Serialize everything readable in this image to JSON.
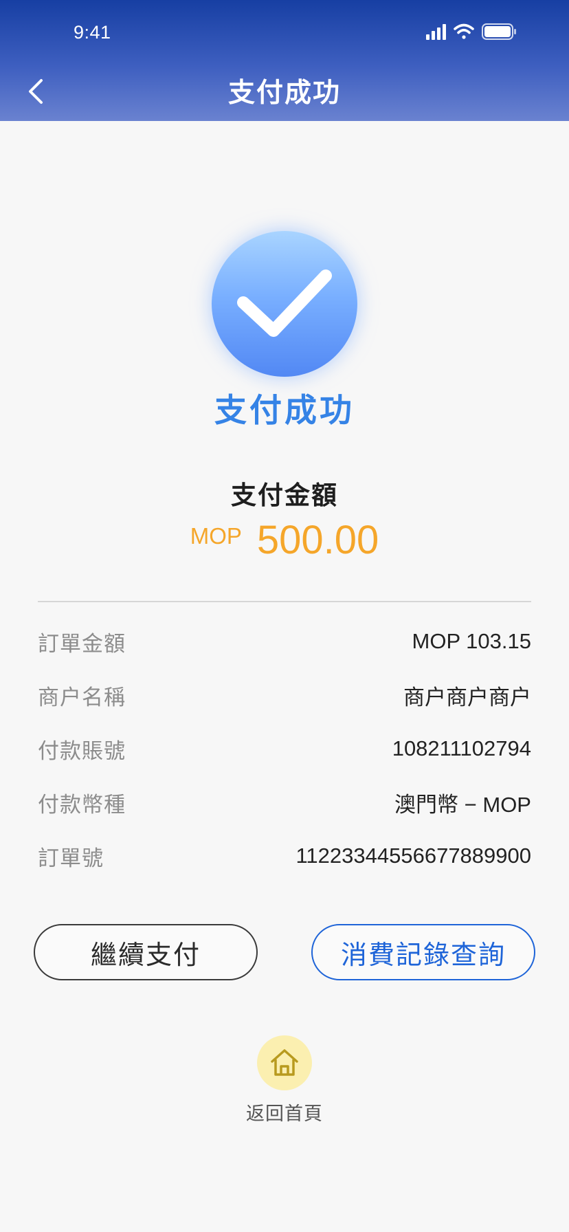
{
  "status_bar": {
    "time": "9:41"
  },
  "header": {
    "title": "支付成功",
    "back_icon": "chevron-left-icon"
  },
  "result": {
    "title": "支付成功",
    "icon": "check-icon",
    "color": "#3583e6"
  },
  "amount": {
    "label": "支付金額",
    "currency": "MOP",
    "value": "500.00",
    "color": "#f5a62a"
  },
  "details": [
    {
      "label": "訂單金額",
      "value": "MOP 103.15"
    },
    {
      "label": "商户名稱",
      "value": "商户商户商户"
    },
    {
      "label": "付款賬號",
      "value": "108211102794"
    },
    {
      "label": "付款幣種",
      "value": "澳門幣 − MOP"
    },
    {
      "label": "訂單號",
      "value": "1122334455667788​9900"
    }
  ],
  "buttons": {
    "continue_label": "繼續支付",
    "history_label": "消費記錄查詢"
  },
  "home": {
    "icon": "home-icon",
    "label": "返回首頁"
  }
}
